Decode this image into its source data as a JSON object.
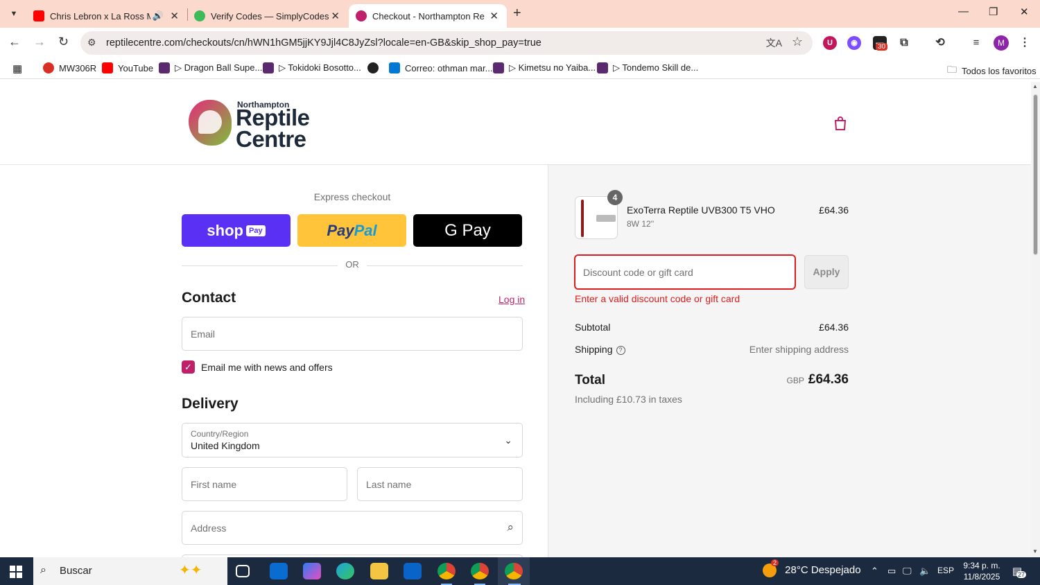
{
  "browser": {
    "tabs": [
      {
        "title": "Chris Lebron x La Ross Mar",
        "favicon_color": "#ff0000",
        "muted_icon": "speaker-icon"
      },
      {
        "title": "Verify Codes — SimplyCodes",
        "favicon_color": "#3dbb5a"
      },
      {
        "title": "Checkout - Northampton Repti",
        "favicon_color": "#c0206a",
        "active": true
      }
    ],
    "url": "reptilecentre.com/checkouts/cn/hWN1hGM5jjKY9Jjl4C8JyZsl?locale=en-GB&skip_shop_pay=true",
    "extension_badge": "30",
    "profile_initial": "M",
    "bookmarks": [
      {
        "label": "MW306R",
        "color": "#d93025"
      },
      {
        "label": "YouTube",
        "color": "#ff0000"
      },
      {
        "label": "▷ Dragon Ball Supe...",
        "color": "#5b2a6e"
      },
      {
        "label": "▷ Tokidoki Bosotto...",
        "color": "#5b2a6e"
      },
      {
        "label": "",
        "color": "#222222"
      },
      {
        "label": "Correo: othman mar...",
        "color": "#0078d4"
      },
      {
        "label": "▷ Kimetsu no Yaiba...",
        "color": "#5b2a6e"
      },
      {
        "label": "▷ Tondemo Skill de...",
        "color": "#5b2a6e"
      }
    ],
    "all_bookmarks": "Todos los favoritos"
  },
  "store": {
    "logo_small": "Northampton",
    "logo_line1": "Reptile",
    "logo_line2": "Centre",
    "accent": "#c0206a"
  },
  "checkout": {
    "express_label": "Express checkout",
    "shop_label": "shop",
    "shop_pay_tag": "Pay",
    "paypal_a": "Pay",
    "paypal_b": "Pal",
    "gpay_label": "G Pay",
    "or_label": "OR",
    "contact_heading": "Contact",
    "login_label": "Log in",
    "email_placeholder": "Email",
    "newsletter_label": "Email me with news and offers",
    "newsletter_checked": true,
    "delivery_heading": "Delivery",
    "country_label": "Country/Region",
    "country_value": "United Kingdom",
    "first_name_placeholder": "First name",
    "last_name_placeholder": "Last name",
    "address_placeholder": "Address"
  },
  "summary": {
    "product_name": "ExoTerra Reptile UVB300 T5 VHO",
    "product_variant": "8W 12''",
    "product_qty": "4",
    "product_price": "£64.36",
    "discount_placeholder": "Discount code or gift card",
    "apply_label": "Apply",
    "discount_error": "Enter a valid discount code or gift card",
    "subtotal_label": "Subtotal",
    "subtotal_value": "£64.36",
    "shipping_label": "Shipping",
    "shipping_value": "Enter shipping address",
    "total_label": "Total",
    "currency": "GBP",
    "total_value": "£64.36",
    "taxes_note": "Including £10.73 in taxes"
  },
  "taskbar": {
    "search_label": "Buscar",
    "weather_badge": "2",
    "weather": "28°C Despejado",
    "language": "ESP",
    "time": "9:34 p. m.",
    "date": "11/8/2025",
    "notifications": "27"
  }
}
